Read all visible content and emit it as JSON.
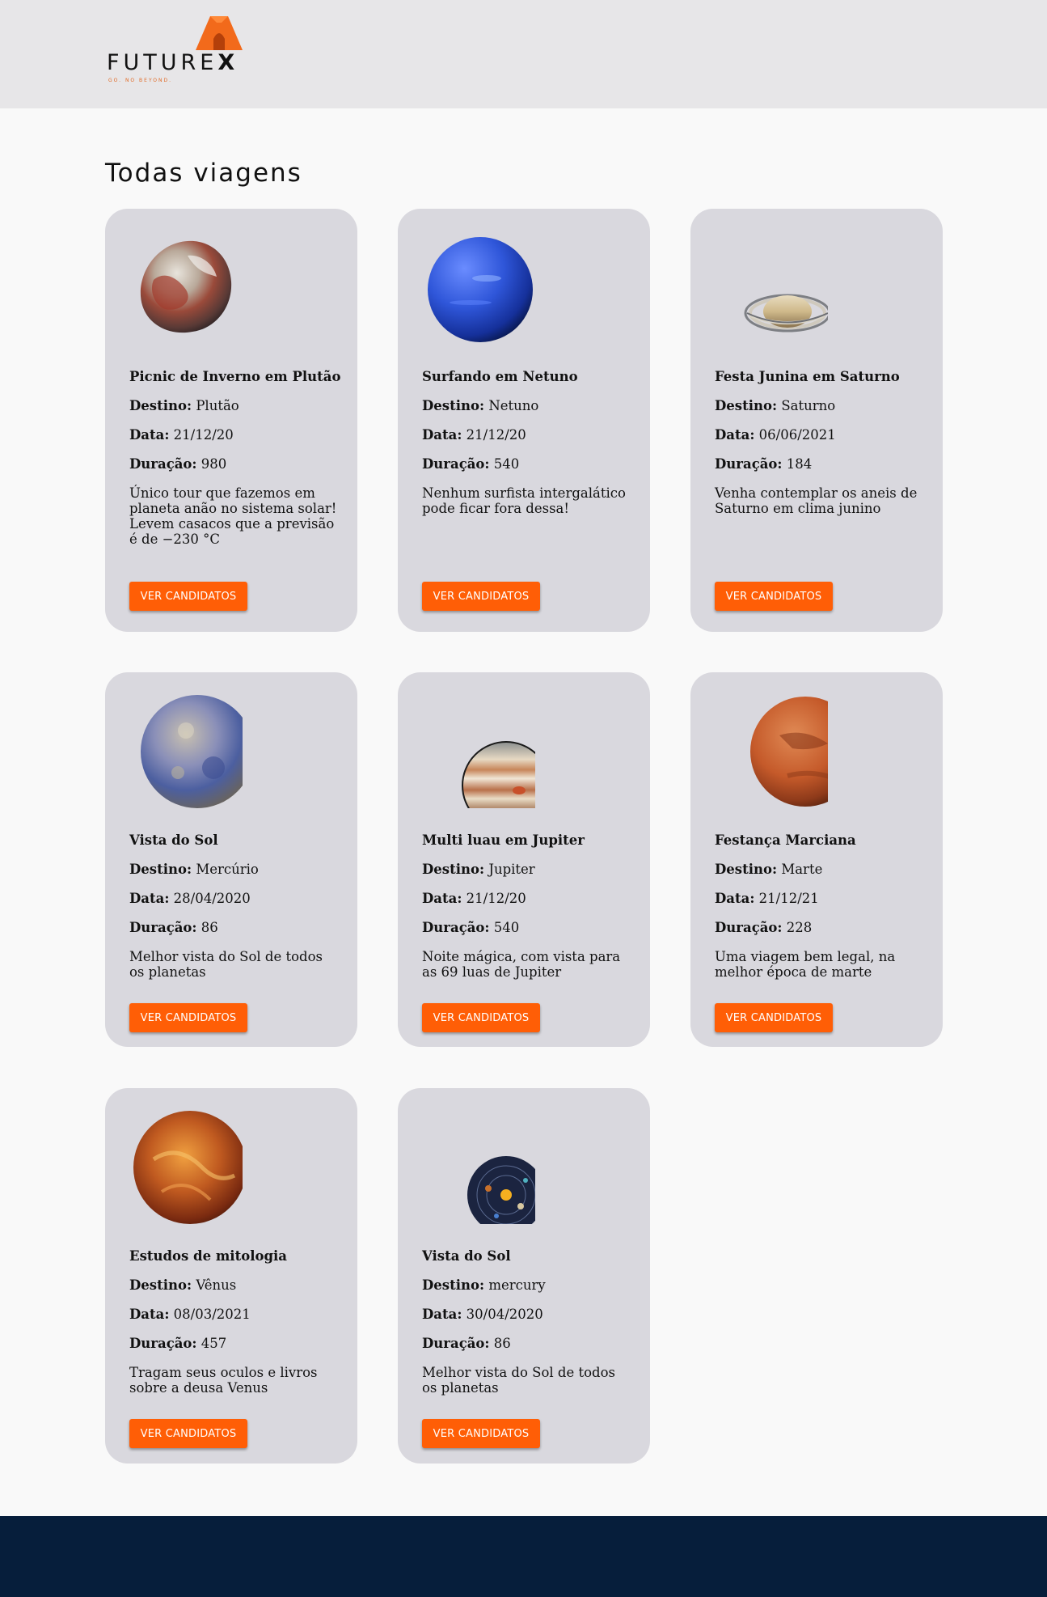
{
  "header": {
    "logo_text_main": "FUTURE",
    "logo_text_x": "X",
    "logo_tagline": "GO. NO BEYOND."
  },
  "main": {
    "title": "Todas viagens"
  },
  "labels": {
    "destino": "Destino:",
    "data": "Data:",
    "duracao": "Duração:"
  },
  "trips": [
    {
      "title": "Picnic de Inverno em Plutão",
      "destino": "Plutão",
      "data": "21/12/20",
      "duracao": "980",
      "description": "Único tour que fazemos em planeta anão no sistema solar! Levem casacos que a previsão é de −230 °C",
      "button": "VER CANDIDATOS",
      "planet_icon": "pluto-icon"
    },
    {
      "title": "Surfando em Netuno",
      "destino": "Netuno",
      "data": "21/12/20",
      "duracao": "540",
      "description": "Nenhum surfista intergalático pode ficar fora dessa!",
      "button": "VER CANDIDATOS",
      "planet_icon": "neptune-icon"
    },
    {
      "title": "Festa Junina em Saturno",
      "destino": "Saturno",
      "data": "06/06/2021",
      "duracao": "184",
      "description": "Venha contemplar os aneis de Saturno em clima junino",
      "button": "VER CANDIDATOS",
      "planet_icon": "saturn-icon"
    },
    {
      "title": "Vista do Sol",
      "destino": "Mercúrio",
      "data": "28/04/2020",
      "duracao": "86",
      "description": "Melhor vista do Sol de todos os planetas",
      "button": "VER CANDIDATOS",
      "planet_icon": "mercury-icon"
    },
    {
      "title": "Multi luau em Jupiter",
      "destino": "Jupiter",
      "data": "21/12/20",
      "duracao": "540",
      "description": "Noite mágica, com vista para as 69 luas de Jupiter",
      "button": "VER CANDIDATOS",
      "planet_icon": "jupiter-icon"
    },
    {
      "title": "Festança Marciana",
      "destino": "Marte",
      "data": "21/12/21",
      "duracao": "228",
      "description": "Uma viagem bem legal, na melhor época de marte",
      "button": "VER CANDIDATOS",
      "planet_icon": "mars-icon"
    },
    {
      "title": "Estudos de mitologia",
      "destino": "Vênus",
      "data": "08/03/2021",
      "duracao": "457",
      "description": "Tragam seus oculos e livros sobre a deusa Venus",
      "button": "VER CANDIDATOS",
      "planet_icon": "venus-icon"
    },
    {
      "title": "Vista do Sol",
      "destino": "mercury",
      "data": "30/04/2020",
      "duracao": "86",
      "description": "Melhor vista do Sol de todos os planetas",
      "button": "VER CANDIDATOS",
      "planet_icon": "solar-system-icon"
    }
  ],
  "colors": {
    "accent": "#ff5e06",
    "card": "#d9d8de",
    "header": "#e7e6e8",
    "footer": "#061e3b"
  }
}
